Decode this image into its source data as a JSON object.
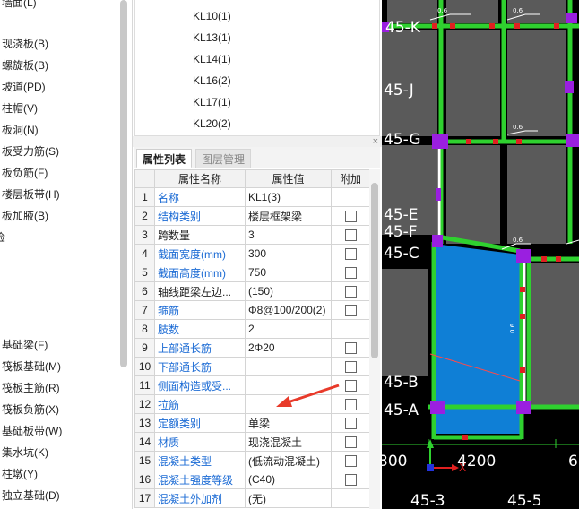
{
  "tree": {
    "top_cut": "墙面(L)",
    "items_a": [
      "现浇板(B)",
      "螺旋板(B)",
      "坡道(PD)",
      "柱帽(V)",
      "板洞(N)",
      "板受力筋(S)",
      "板负筋(F)",
      "楼层板带(H)",
      "板加腋(B)"
    ],
    "cut_item": "俭",
    "items_b": [
      "基础梁(F)",
      "筏板基础(M)",
      "筏板主筋(R)",
      "筏板负筋(X)",
      "基础板带(W)",
      "集水坑(K)",
      "柱墩(Y)",
      "独立基础(D)"
    ]
  },
  "beam_list": [
    "KL10(1)",
    "KL13(1)",
    "KL14(1)",
    "KL16(2)",
    "KL17(1)",
    "KL20(2)"
  ],
  "close_glyph": "×",
  "tabs": {
    "props": "属性列表",
    "layers": "图层管理"
  },
  "grid": {
    "headers": [
      "",
      "属性名称",
      "属性值",
      "附加"
    ],
    "rows": [
      {
        "n": "1",
        "name": "名称",
        "value": "KL1(3)",
        "blue": true,
        "cb": false
      },
      {
        "n": "2",
        "name": "结构类别",
        "value": "楼层框架梁",
        "blue": true,
        "cb": true
      },
      {
        "n": "3",
        "name": "跨数量",
        "value": "3",
        "blue": false,
        "cb": true
      },
      {
        "n": "4",
        "name": "截面宽度(mm)",
        "value": "300",
        "blue": true,
        "cb": true
      },
      {
        "n": "5",
        "name": "截面高度(mm)",
        "value": "750",
        "blue": true,
        "cb": true
      },
      {
        "n": "6",
        "name": "轴线距梁左边...",
        "value": "(150)",
        "blue": false,
        "cb": true
      },
      {
        "n": "7",
        "name": "箍筋",
        "value": "Φ8@100/200(2)",
        "blue": true,
        "cb": true
      },
      {
        "n": "8",
        "name": "肢数",
        "value": "2",
        "blue": true,
        "cb": false
      },
      {
        "n": "9",
        "name": "上部通长筋",
        "value": "2Φ20",
        "blue": true,
        "cb": true
      },
      {
        "n": "10",
        "name": "下部通长筋",
        "value": "",
        "blue": true,
        "cb": true
      },
      {
        "n": "11",
        "name": "侧面构造或受...",
        "value": "",
        "blue": true,
        "cb": true
      },
      {
        "n": "12",
        "name": "拉筋",
        "value": "",
        "blue": true,
        "cb": true
      },
      {
        "n": "13",
        "name": "定额类别",
        "value": "单梁",
        "blue": true,
        "cb": true
      },
      {
        "n": "14",
        "name": "材质",
        "value": "现浇混凝土",
        "blue": true,
        "cb": true
      },
      {
        "n": "15",
        "name": "混凝土类型",
        "value": "(低流动混凝土)",
        "blue": true,
        "cb": true
      },
      {
        "n": "16",
        "name": "混凝土强度等级",
        "value": "(C40)",
        "blue": true,
        "cb": true
      },
      {
        "n": "17",
        "name": "混凝土外加剂",
        "value": "(无)",
        "blue": true,
        "cb": false
      }
    ]
  },
  "cad": {
    "axes_y": [
      "45-K",
      "45-J",
      "45-G",
      "45-E",
      "45-F",
      "45-C",
      "45-B",
      "45-A"
    ],
    "dims": [
      "300",
      "4200"
    ],
    "axes_x": [
      "45-3",
      "45-5"
    ],
    "edge_digit": "6",
    "beam_tag": "0.6",
    "origin_label": "X"
  }
}
